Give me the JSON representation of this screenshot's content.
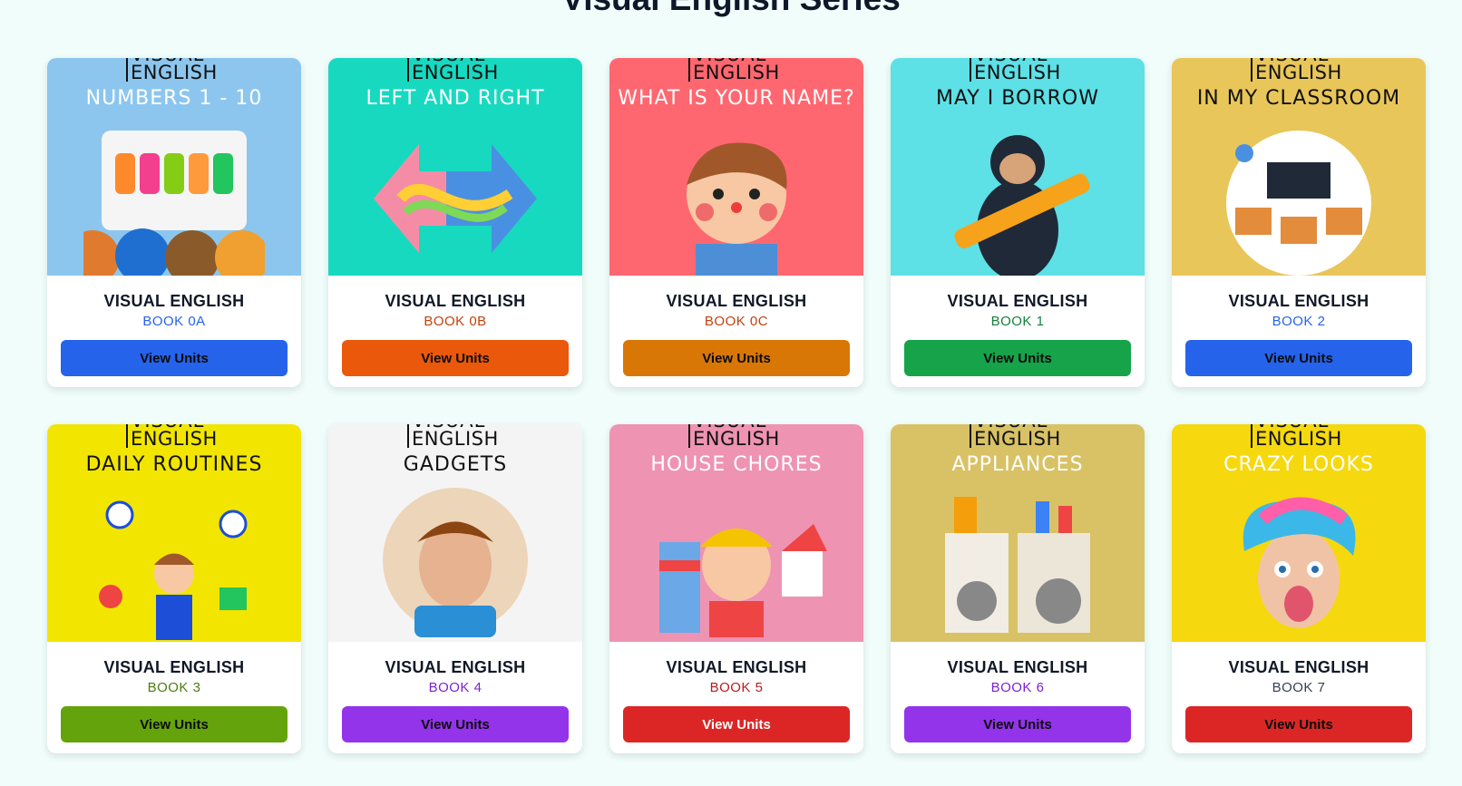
{
  "page_title": "Visual English Series",
  "cards": [
    {
      "series": "VISUAL ENGLISH",
      "book": "BOOK 0A",
      "button": "View Units",
      "cover_title": "NUMBERS 1 - 10",
      "cover_bg": "#8cc6ee",
      "title_color": "#ffffff",
      "book_color": "#2563eb",
      "button_color": "#2563eb",
      "art": "number-blocks",
      "icon": "numbers-icon"
    },
    {
      "series": "VISUAL ENGLISH",
      "book": "BOOK 0B",
      "button": "View Units",
      "cover_title": "LEFT AND RIGHT",
      "cover_bg": "#17d9c0",
      "title_color": "#ffffff",
      "book_color": "#c2410c",
      "button_color": "#ea580c",
      "art": "arrows",
      "icon": "arrows-icon"
    },
    {
      "series": "VISUAL ENGLISH",
      "book": "BOOK 0C",
      "button": "View Units",
      "cover_title": "WHAT IS YOUR NAME?",
      "cover_bg": "#ff6770",
      "title_color": "#ffffff",
      "book_color": "#c2410c",
      "button_color": "#d97706",
      "art": "boy",
      "icon": "boy-icon"
    },
    {
      "series": "VISUAL ENGLISH",
      "book": "BOOK 1",
      "button": "View Units",
      "cover_title": "MAY I BORROW",
      "cover_bg": "#5de0e6",
      "title_color": "#111111",
      "book_color": "#15803d",
      "button_color": "#16a34a",
      "art": "monkey",
      "icon": "monkey-icon"
    },
    {
      "series": "VISUAL ENGLISH",
      "book": "BOOK 2",
      "button": "View Units",
      "cover_title": "IN MY CLASSROOM",
      "cover_bg": "#e9c65a",
      "title_color": "#111111",
      "book_color": "#2563eb",
      "button_color": "#2563eb",
      "art": "classroom",
      "icon": "classroom-icon"
    },
    {
      "series": "VISUAL ENGLISH",
      "book": "BOOK 3",
      "button": "View Units",
      "cover_title": "DAILY ROUTINES",
      "cover_bg": "#f2e600",
      "title_color": "#111111",
      "book_color": "#4d7c0f",
      "button_color": "#65a30d",
      "art": "routines",
      "icon": "clock-icon"
    },
    {
      "series": "VISUAL ENGLISH",
      "book": "BOOK 4",
      "button": "View Units",
      "cover_title": "GADGETS",
      "cover_bg": "#f4f4f4",
      "title_color": "#111111",
      "book_color": "#7e22ce",
      "button_color": "#9333ea",
      "art": "gadgets",
      "icon": "gamepad-icon"
    },
    {
      "series": "VISUAL ENGLISH",
      "book": "BOOK 5",
      "button": "View Units",
      "cover_title": "HOUSE CHORES",
      "cover_bg": "#ef93b2",
      "title_color": "#ffffff",
      "book_color": "#b91c1c",
      "button_color": "#dc2626",
      "art": "chores",
      "icon": "house-icon"
    },
    {
      "series": "VISUAL ENGLISH",
      "book": "BOOK 6",
      "button": "View Units",
      "cover_title": "APPLIANCES",
      "cover_bg": "#d9c265",
      "title_color": "#ffffff",
      "book_color": "#7e22ce",
      "button_color": "#9333ea",
      "art": "appliances",
      "icon": "washing-machine-icon"
    },
    {
      "series": "VISUAL ENGLISH",
      "book": "BOOK 7",
      "button": "View Units",
      "cover_title": "CRAZY LOOKS",
      "cover_bg": "#f6d80e",
      "title_color": "#ffffff",
      "book_color": "#374151",
      "button_color": "#dc2626",
      "art": "crazy",
      "icon": "face-icon"
    }
  ]
}
